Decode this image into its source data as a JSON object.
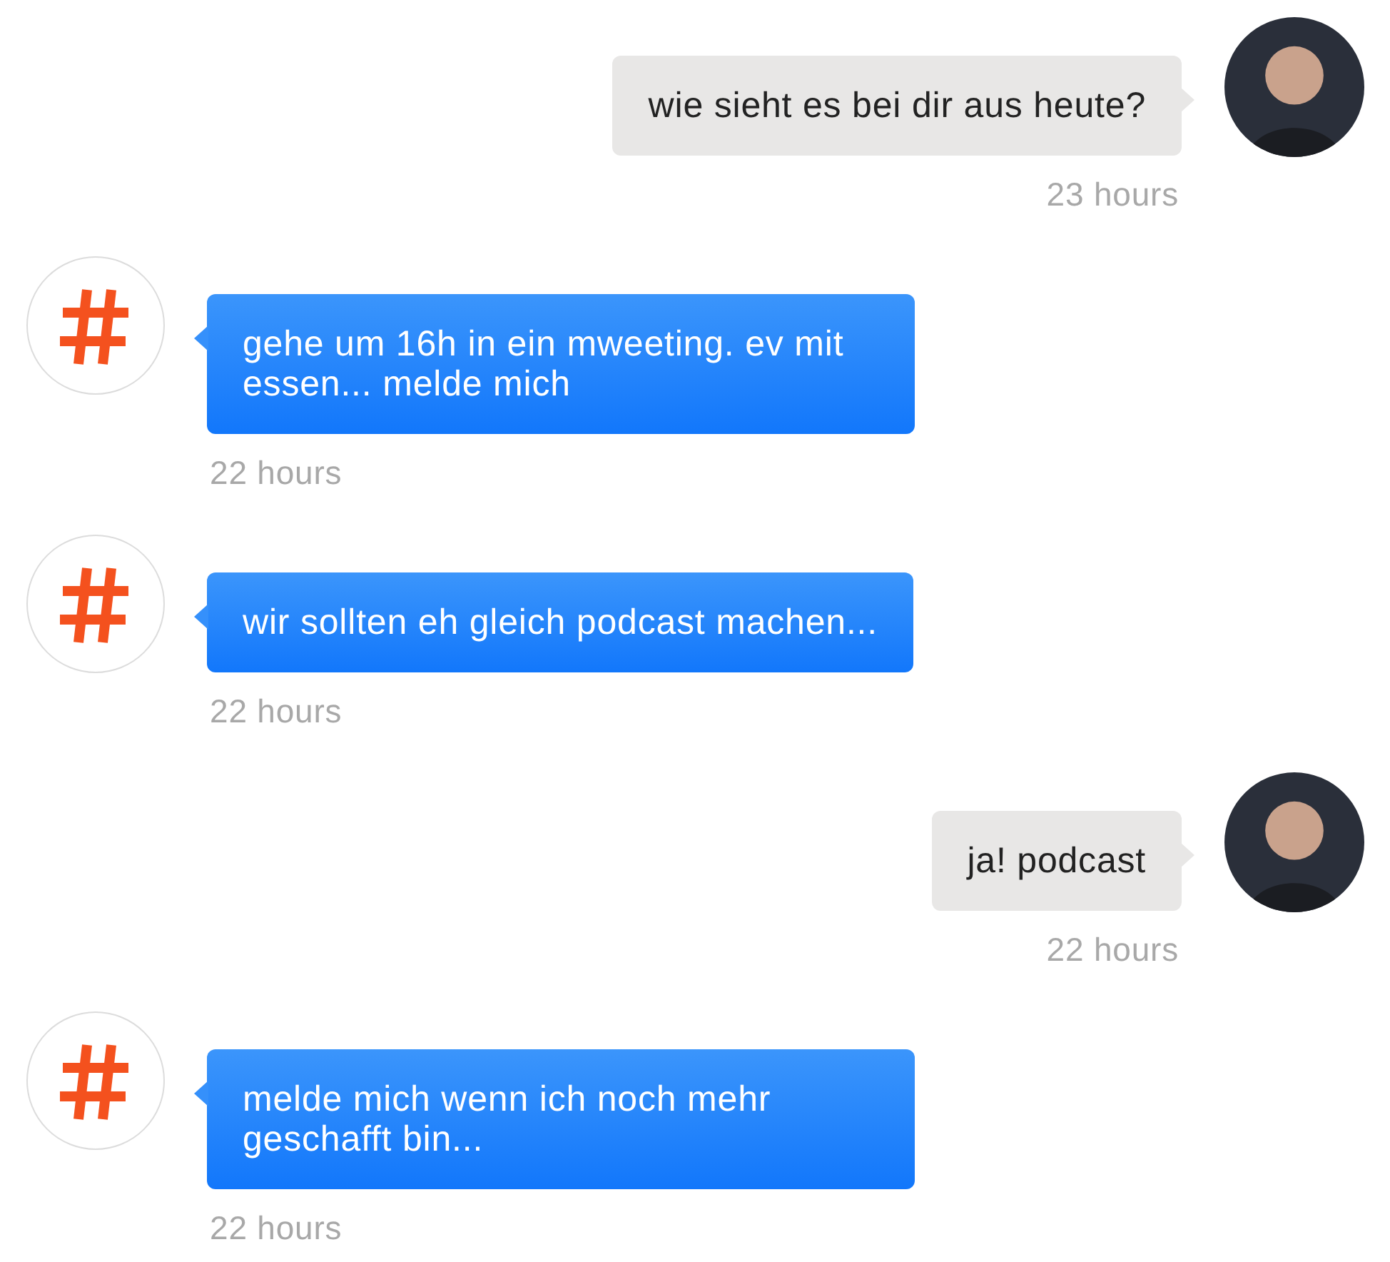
{
  "messages": [
    {
      "kind": "outgoing",
      "text": "wie sieht es bei dir aus heute?",
      "time": "23 hours"
    },
    {
      "kind": "incoming",
      "text": "gehe um 16h in ein mweeting. ev mit essen... melde mich",
      "time": "22 hours"
    },
    {
      "kind": "incoming",
      "text": "wir sollten eh gleich podcast machen...",
      "time": "22 hours"
    },
    {
      "kind": "outgoing",
      "text": "ja! podcast",
      "time": "22 hours"
    },
    {
      "kind": "incoming",
      "text": "melde mich wenn ich noch mehr geschafft bin...",
      "time": "22 hours"
    }
  ]
}
